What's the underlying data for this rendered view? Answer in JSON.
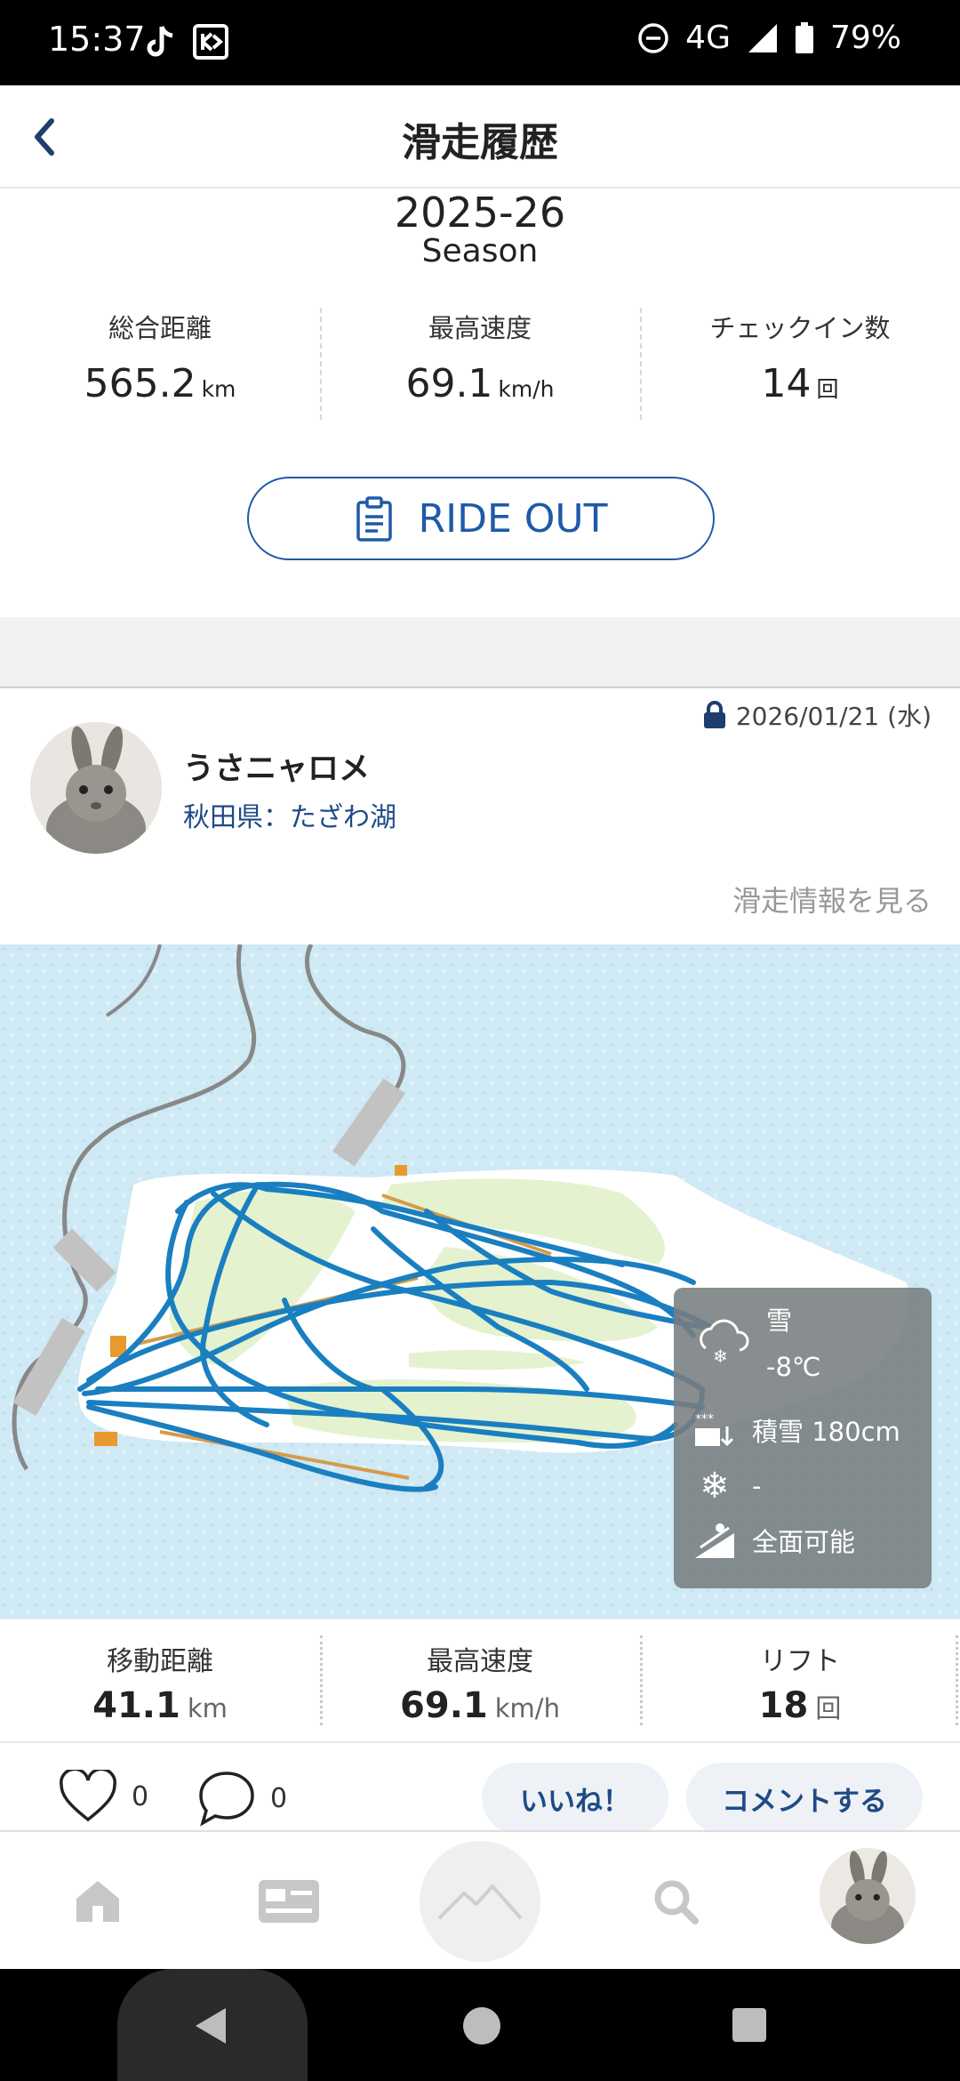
{
  "status_bar": {
    "time": "15:37",
    "network": "4G",
    "battery": "79%"
  },
  "app_bar": {
    "title": "滑走履歴"
  },
  "season": {
    "year": "2025-26",
    "label": "Season"
  },
  "season_stats": [
    {
      "label": "総合距離",
      "value": "565.2",
      "unit": "km"
    },
    {
      "label": "最高速度",
      "value": "69.1",
      "unit": "km/h"
    },
    {
      "label": "チェックイン数",
      "value": "14",
      "unit": "回"
    }
  ],
  "ride_out_button": {
    "label": "RIDE OUT"
  },
  "post": {
    "date": "2026/01/21 (水)",
    "username": "うさニャロメ",
    "location": "秋田県：たざわ湖",
    "view_info_link": "滑走情報を見る",
    "weather": {
      "condition": "雪",
      "temperature": "-8℃",
      "snow_depth": "積雪 180cm",
      "new_snow": "-",
      "course_status": "全面可能"
    },
    "stats": [
      {
        "label": "移動距離",
        "value": "41.1",
        "unit": "km"
      },
      {
        "label": "最高速度",
        "value": "69.1",
        "unit": "km/h"
      },
      {
        "label": "リフト",
        "value": "18",
        "unit": "回"
      }
    ],
    "likes": "0",
    "comments": "0",
    "like_button": "いいね！",
    "comment_button": "コメントする"
  },
  "colors": {
    "accent": "#1e5aa8",
    "track": "#1a7fc0",
    "map_bg": "#cde9f5",
    "slope": "#e4f2cf"
  },
  "bottom_nav": [
    "home-icon",
    "card-icon",
    "mountain-icon",
    "search-icon",
    "avatar"
  ]
}
